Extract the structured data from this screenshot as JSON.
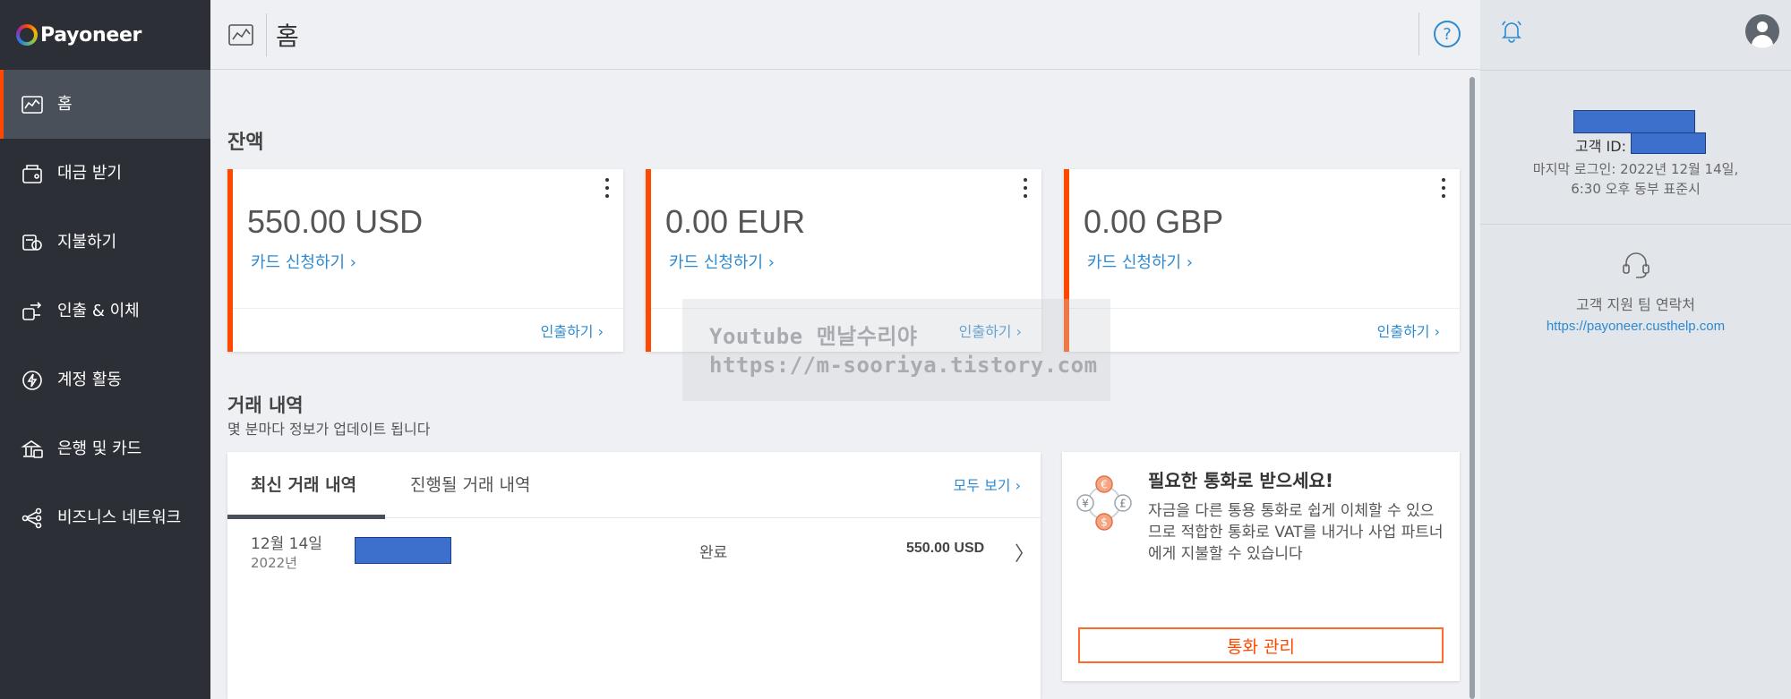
{
  "brand": {
    "name": "Payoneer"
  },
  "sidebar": {
    "items": [
      {
        "label": "홈",
        "icon": "chart-icon",
        "active": true
      },
      {
        "label": "대금 받기",
        "icon": "wallet-icon"
      },
      {
        "label": "지불하기",
        "icon": "pay-icon"
      },
      {
        "label": "인출 & 이체",
        "icon": "transfer-icon"
      },
      {
        "label": "계정 활동",
        "icon": "activity-icon"
      },
      {
        "label": "은행 및 카드",
        "icon": "bank-icon"
      },
      {
        "label": "비즈니스 네트워크",
        "icon": "network-icon"
      }
    ]
  },
  "header": {
    "title": "홈",
    "help_glyph": "?"
  },
  "balances": {
    "title": "잔액",
    "cards": [
      {
        "amount": "550.00 USD",
        "apply_link": "카드 신청하기 ›",
        "withdraw_link": "인출하기 ›"
      },
      {
        "amount": "0.00 EUR",
        "apply_link": "카드 신청하기 ›",
        "withdraw_link": "인출하기 ›"
      },
      {
        "amount": "0.00 GBP",
        "apply_link": "카드 신청하기 ›",
        "withdraw_link": "인출하기 ›"
      }
    ]
  },
  "watermark": {
    "line1": "Youtube 맨날수리야",
    "line2": "https://m-sooriya.tistory.com"
  },
  "transactions": {
    "title": "거래 내역",
    "subtitle": "몇 분마다 정보가 업데이트 됩니다",
    "tabs": [
      "최신 거래 내역",
      "진행될 거래 내역"
    ],
    "view_all": "모두 보기 ›",
    "rows": [
      {
        "date": "12월 14일",
        "year": "2022년",
        "status": "완료",
        "amount": "550.00 USD",
        "chevron": "〉"
      }
    ]
  },
  "promo": {
    "title": "필요한 통화로 받으세요!",
    "body": "자금을 다른 통용 통화로 쉽게 이체할 수 있으므로 적합한 통화로 VAT를 내거나 사업 파트너에게 지불할 수 있습니다",
    "button": "통화 관리",
    "coin_symbols": [
      "€",
      "¥",
      "£",
      "$"
    ]
  },
  "profile": {
    "customer_id_label": "고객 ID:",
    "last_login": "마지막 로그인: 2022년 12월 14일, 6:30 오후 동부 표준시",
    "support_label": "고객 지원 팀 연락처",
    "support_link": "https://payoneer.custhelp.com"
  },
  "colors": {
    "accent": "#ff4800",
    "link": "#2e8ad0",
    "sidebar": "#2c3036",
    "redaction": "#3d6fcc"
  }
}
